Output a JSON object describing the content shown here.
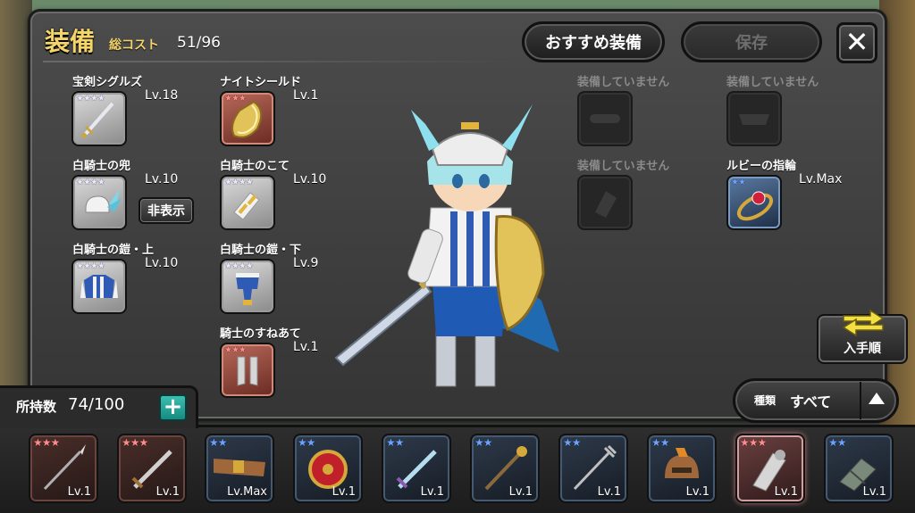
{
  "screen": {
    "title": "装備",
    "cost_label": "総コスト",
    "cost_value": "51/96"
  },
  "header_buttons": {
    "recommend_label": "おすすめ装備",
    "save_label": "保存",
    "close_icon": "close-icon"
  },
  "left_slots": [
    {
      "name": "宝剣シグルズ",
      "level": "Lv.18",
      "rarity": "silver",
      "stars": "★★★★",
      "icon": "sword-icon"
    },
    {
      "name": "白騎士の兜",
      "level": "Lv.10",
      "rarity": "silver",
      "stars": "★★★★",
      "icon": "winged-helmet-icon"
    },
    {
      "name": "白騎士の鎧・上",
      "level": "Lv.10",
      "rarity": "silver",
      "stars": "★★★★",
      "icon": "armor-top-icon"
    }
  ],
  "middle_slots": [
    {
      "name": "ナイトシールド",
      "level": "Lv.1",
      "rarity": "red",
      "stars": "★★★",
      "icon": "shield-icon"
    },
    {
      "name": "白騎士のこて",
      "level": "Lv.10",
      "rarity": "silver",
      "stars": "★★★★",
      "icon": "gauntlet-icon"
    },
    {
      "name": "白騎士の鎧・下",
      "level": "Lv.9",
      "rarity": "silver",
      "stars": "★★★★",
      "icon": "armor-bottom-icon"
    },
    {
      "name": "騎士のすねあて",
      "level": "Lv.1",
      "rarity": "red",
      "stars": "★★★",
      "icon": "greaves-icon"
    }
  ],
  "hide_button_label": "非表示",
  "accessory_slots": [
    {
      "label": "装備していません",
      "icon": "belt-slot-icon"
    },
    {
      "label": "装備していません",
      "icon": "collar-slot-icon"
    },
    {
      "label": "装備していません",
      "icon": "glove-slot-icon"
    },
    {
      "name": "ルビーの指輪",
      "level": "Lv.Max",
      "rarity": "blue",
      "stars": "★★",
      "icon": "ruby-ring-icon"
    }
  ],
  "sort_button_label": "入手順",
  "inventory": {
    "label": "所持数",
    "count": "74/100",
    "add_icon": "plus-icon",
    "filter_kind": "種類",
    "filter_value": "すべて",
    "items": [
      {
        "rarity": "red",
        "stars": "★★★",
        "level": "Lv.1",
        "icon": "spear-icon"
      },
      {
        "rarity": "red",
        "stars": "★★★",
        "level": "Lv.1",
        "icon": "sword-icon"
      },
      {
        "rarity": "blue",
        "stars": "★★",
        "level": "Lv.Max",
        "icon": "belt-icon"
      },
      {
        "rarity": "blue",
        "stars": "★★",
        "level": "Lv.1",
        "icon": "round-shield-icon"
      },
      {
        "rarity": "blue",
        "stars": "★★",
        "level": "Lv.1",
        "icon": "sword-icon"
      },
      {
        "rarity": "blue",
        "stars": "★★",
        "level": "Lv.1",
        "icon": "staff-icon"
      },
      {
        "rarity": "blue",
        "stars": "★★",
        "level": "Lv.1",
        "icon": "trident-icon"
      },
      {
        "rarity": "blue",
        "stars": "★★",
        "level": "Lv.1",
        "icon": "helmet-icon"
      },
      {
        "rarity": "red",
        "stars": "★★★",
        "level": "Lv.1",
        "icon": "gauntlet-icon"
      },
      {
        "rarity": "blue",
        "stars": "★★",
        "level": "Lv.1",
        "icon": "bracer-icon"
      }
    ]
  },
  "colors": {
    "title_gold": "#f4d56a",
    "add_button_teal": "#2aa89a",
    "rarity_red": "#ff8a8a",
    "rarity_blue": "#6aa2ff"
  }
}
